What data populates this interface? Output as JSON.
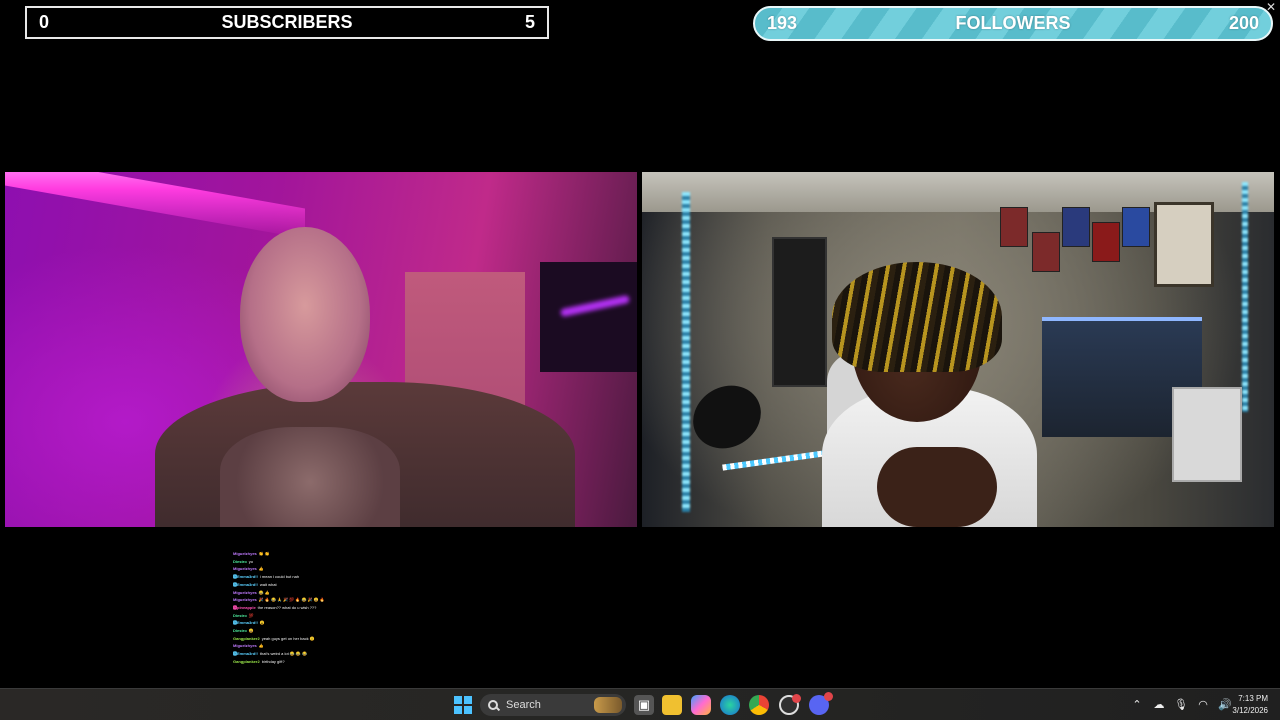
{
  "subscribers_goal": {
    "current": "0",
    "label": "SUBSCRIBERS",
    "target": "5"
  },
  "followers_goal": {
    "current": "193",
    "label": "FOLLOWERS",
    "target": "200"
  },
  "close_label": "✕",
  "chat": [
    {
      "user": "Miguelzhyes",
      "msg": "👏 👏",
      "color": "#c07bff"
    },
    {
      "user": "Diestro",
      "msg": "yo",
      "color": "#4ff0a0"
    },
    {
      "user": "Miguelzhyes",
      "msg": "👍",
      "color": "#c07bff"
    },
    {
      "user": "🅶Emma3rd!!",
      "msg": "i mean i could but nah",
      "color": "#5ad0ff"
    },
    {
      "user": "🅶Emma3rd!!",
      "msg": "wait what",
      "color": "#5ad0ff"
    },
    {
      "user": "Miguelzhyes",
      "msg": "😂 👍",
      "color": "#c07bff"
    },
    {
      "user": "Miguelzhyes",
      "msg": "🎉 🔥 😂 🙏 🎉 💯 🔥 😂 🎉 😀 🔥",
      "color": "#c07bff"
    },
    {
      "user": "🅶pineapple",
      "msg": "the reason?? what do u wish ???",
      "color": "#ff4fb3"
    },
    {
      "user": "Diestro",
      "msg": "💯",
      "color": "#4ff0a0"
    },
    {
      "user": "🅶Emma3rd!!",
      "msg": "😮",
      "color": "#5ad0ff"
    },
    {
      "user": "Diestro",
      "msg": "😄",
      "color": "#4ff0a0"
    },
    {
      "user": "Gangplanker2",
      "msg": "yeah guys get on her back 🙂",
      "color": "#9be84a"
    },
    {
      "user": "Miguelzhyes",
      "msg": "👍",
      "color": "#c07bff"
    },
    {
      "user": "🅶Emma3rd!!",
      "msg": "that's weird a lot 😂 😂 😂",
      "color": "#5ad0ff"
    },
    {
      "user": "Gangplanker2",
      "msg": "birthday gift?",
      "color": "#9be84a"
    }
  ],
  "taskbar": {
    "search_label": "Search",
    "time": "7:13 PM",
    "date": "3/12/2026",
    "icons": [
      "windows-icon",
      "search-icon",
      "task-view-icon",
      "file-explorer-icon",
      "copilot-icon",
      "edge-icon",
      "chrome-icon",
      "obs-icon",
      "discord-icon"
    ]
  },
  "colors": {
    "followers_bar": "#72cfdc",
    "subscribers_border": "#e8e8e8",
    "accent": "#4cc2ff"
  }
}
